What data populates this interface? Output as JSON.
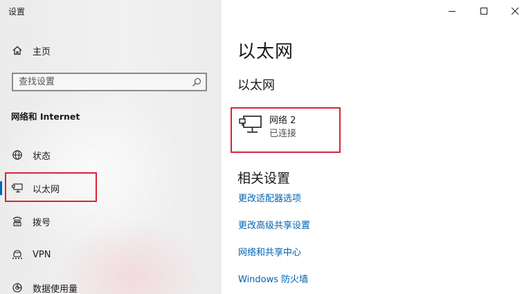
{
  "app": {
    "title": "设置"
  },
  "window_controls": {
    "minimize_icon": "minimize-icon",
    "maximize_icon": "maximize-icon",
    "close_icon": "close-icon"
  },
  "sidebar": {
    "home": {
      "label": "主页",
      "icon": "home-icon"
    },
    "search": {
      "placeholder": "查找设置",
      "icon": "search-icon"
    },
    "section_title": "网络和 Internet",
    "items": [
      {
        "label": "状态",
        "icon": "globe-icon",
        "selected": false
      },
      {
        "label": "以太网",
        "icon": "ethernet-icon",
        "selected": true
      },
      {
        "label": "拨号",
        "icon": "dialup-icon",
        "selected": false
      },
      {
        "label": "VPN",
        "icon": "vpn-icon",
        "selected": false
      },
      {
        "label": "数据使用量",
        "icon": "data-usage-icon",
        "selected": false
      }
    ]
  },
  "main": {
    "page_title": "以太网",
    "subheading": "以太网",
    "network": {
      "name": "网络 2",
      "status": "已连接",
      "icon": "network-monitor-icon"
    },
    "related_settings": {
      "heading": "相关设置",
      "links": [
        "更改适配器选项",
        "更改高级共享设置",
        "网络和共享中心",
        "Windows 防火墙"
      ]
    }
  },
  "colors": {
    "accent": "#0067c0",
    "link": "#0063b1",
    "highlight_box": "#d42636",
    "sidebar_bg": "#ececec"
  }
}
